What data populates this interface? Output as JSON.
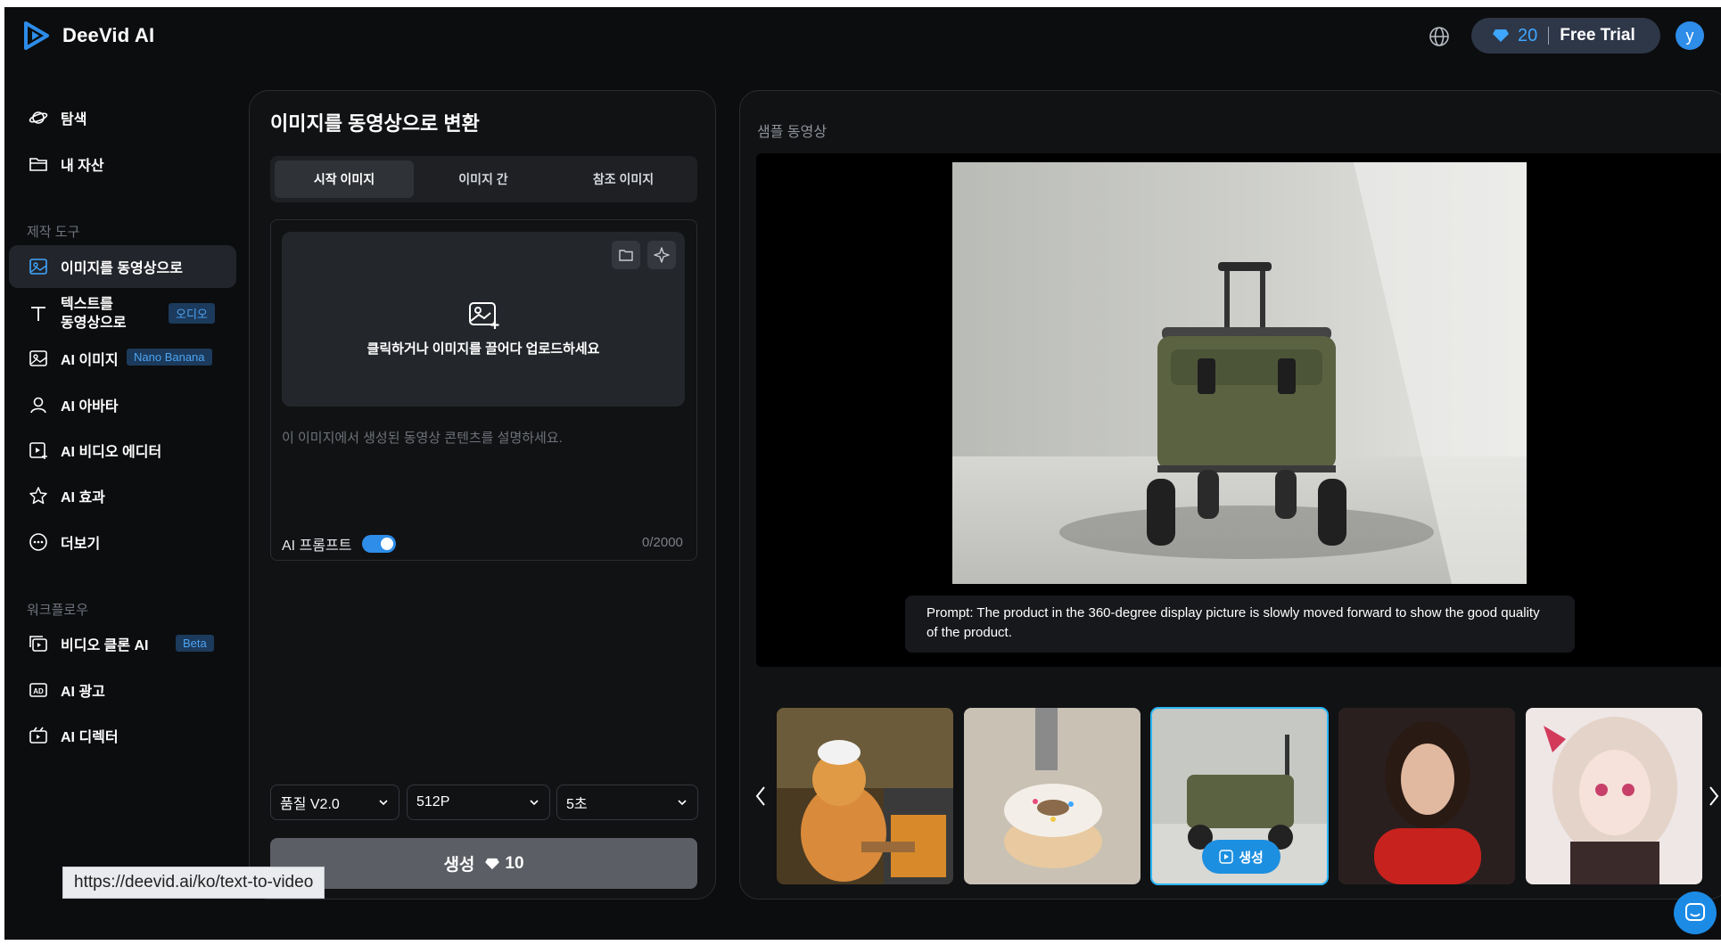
{
  "header": {
    "brand": "DeeVid AI",
    "credits_count": "20",
    "trial_label": "Free Trial",
    "avatar_initial": "y",
    "accent_color": "#2d8de9"
  },
  "sidebar": {
    "items_top": [
      {
        "label": "탐색",
        "icon": "planet-icon"
      },
      {
        "label": "내 자산",
        "icon": "folder-icon"
      }
    ],
    "section_tools": "제작 도구",
    "tools": [
      {
        "label": "이미지를 동영상으로",
        "icon": "image-icon",
        "active": true
      },
      {
        "label": "텍스트를\n동영상으로",
        "icon": "text-icon",
        "badge": "오디오"
      },
      {
        "label": "AI 이미지",
        "icon": "ai-image-icon",
        "badge": "Nano Banana"
      },
      {
        "label": "AI 아바타",
        "icon": "avatar-icon"
      },
      {
        "label": "AI 비디오 에디터",
        "icon": "video-editor-icon"
      },
      {
        "label": "AI 효과",
        "icon": "star-icon"
      },
      {
        "label": "더보기",
        "icon": "more-icon"
      }
    ],
    "section_workflow": "워크플로우",
    "workflow": [
      {
        "label": "비디오 클론 AI",
        "icon": "clone-icon",
        "badge": "Beta"
      },
      {
        "label": "AI 광고",
        "icon": "ad-icon"
      },
      {
        "label": "AI 디렉터",
        "icon": "director-icon"
      }
    ]
  },
  "left_panel": {
    "title": "이미지를 동영상으로 변환",
    "tabs": [
      "시작 이미지",
      "이미지 간",
      "참조 이미지"
    ],
    "active_tab": "시작 이미지",
    "upload_text": "클릭하거나 이미지를 끌어다 업로드하세요",
    "prompt_placeholder": "이 이미지에서 생성된 동영상 콘텐츠를 설명하세요.",
    "ai_prompt_label": "AI 프롬프트",
    "ai_prompt_enabled": true,
    "char_counter": "0/2000",
    "quality": "품질 V2.0",
    "resolution": "512P",
    "duration": "5초",
    "generate_label": "생성",
    "generate_cost": "10"
  },
  "right_panel": {
    "sample_label": "샘플 동영상",
    "prompt_prefix": "Prompt:",
    "prompt_text": "The product in the 360-degree display picture is slowly moved forward to show the good quality of the product.",
    "thumb_generate_label": "생성",
    "thumbnails": [
      "cat-baker",
      "donut-robot",
      "garden-cart",
      "woman-red-sweater",
      "anime-girl"
    ],
    "selected_thumbnail": 2
  },
  "status_url": "https://deevid.ai/ko/text-to-video"
}
